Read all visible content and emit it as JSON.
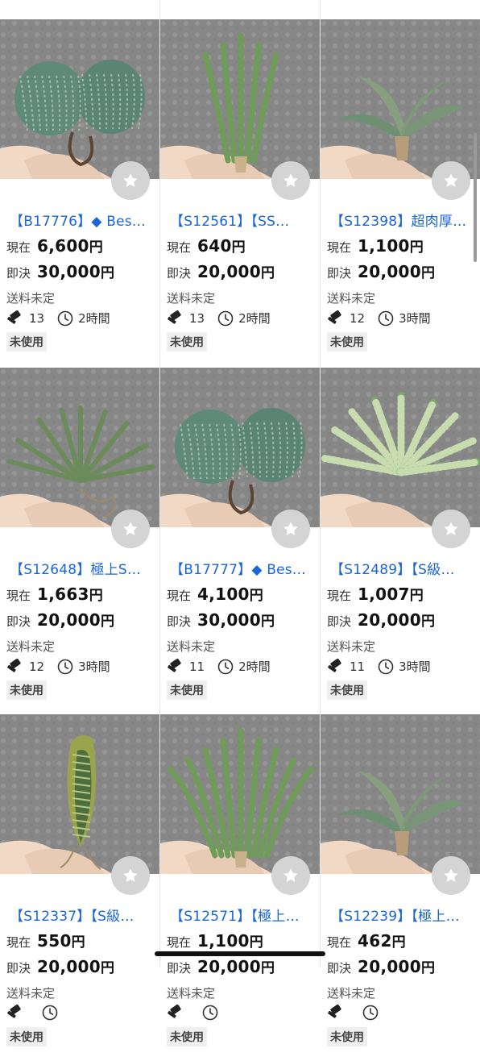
{
  "labels": {
    "current": "現在",
    "buyout": "即決",
    "shipping": "送料未定",
    "yen": "円",
    "condition": "未使用"
  },
  "icons": {
    "favorite": "star-icon",
    "bid": "gavel-icon",
    "time": "clock-icon"
  },
  "colors": {
    "title": "#1a66d6",
    "fav_bg": "#d4d4d4",
    "badge_bg": "#efefef"
  },
  "items": [
    {
      "title": "【B17776】◆ Bes…",
      "current": "6,600",
      "buyout": "30,000",
      "bids": "13",
      "time": "2時間",
      "plant": "globe-twin"
    },
    {
      "title": "【S12561】【SS…",
      "current": "640",
      "buyout": "20,000",
      "bids": "13",
      "time": "2時間",
      "plant": "thin-spikes"
    },
    {
      "title": "【S12398】超肉厚…",
      "current": "1,100",
      "buyout": "20,000",
      "bids": "12",
      "time": "3時間",
      "plant": "fan"
    },
    {
      "title": "【S12648】極上S…",
      "current": "1,663",
      "buyout": "20,000",
      "bids": "12",
      "time": "3時間",
      "plant": "spiky-rosette"
    },
    {
      "title": "【B17777】◆ Bes…",
      "current": "4,100",
      "buyout": "30,000",
      "bids": "11",
      "time": "2時間",
      "plant": "globe-twin"
    },
    {
      "title": "【S12489】【S級…",
      "current": "1,007",
      "buyout": "20,000",
      "bids": "11",
      "time": "3時間",
      "plant": "striped-rosette"
    },
    {
      "title": "【S12337】【S級…",
      "current": "550",
      "buyout": "20,000",
      "bids": "",
      "time": "",
      "plant": "single-leaf"
    },
    {
      "title": "【S12571】【極上…",
      "current": "1,100",
      "buyout": "20,000",
      "bids": "",
      "time": "",
      "plant": "tall-spikes"
    },
    {
      "title": "【S12239】【極上…",
      "current": "462",
      "buyout": "20,000",
      "bids": "",
      "time": "",
      "plant": "wing"
    }
  ]
}
